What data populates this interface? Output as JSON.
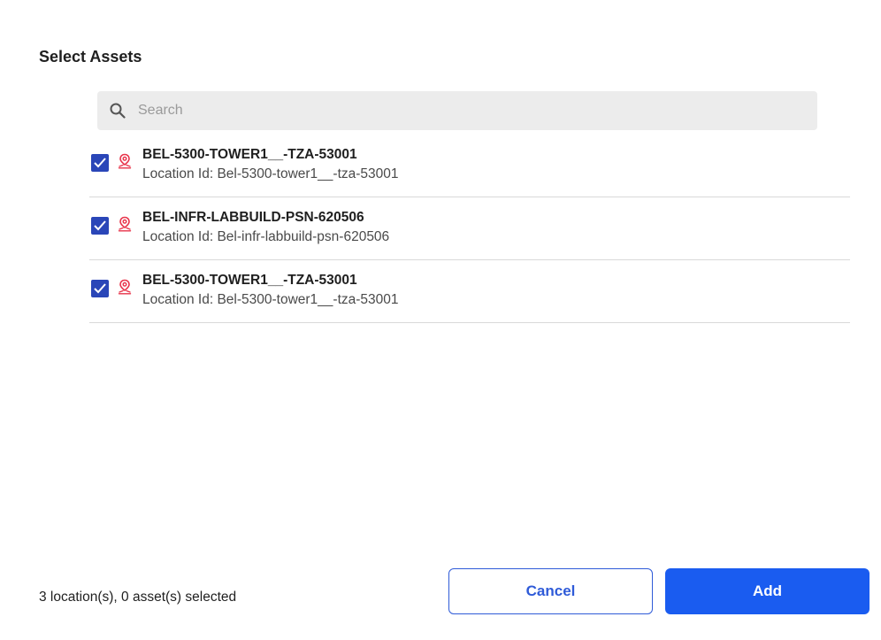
{
  "dialog": {
    "title": "Select Assets"
  },
  "search": {
    "placeholder": "Search",
    "value": ""
  },
  "items": [
    {
      "name": "BEL-5300-TOWER1__-TZA-53001",
      "location": "Location Id: Bel-5300-tower1__-tza-53001",
      "checked": true
    },
    {
      "name": "BEL-INFR-LABBUILD-PSN-620506",
      "location": "Location Id: Bel-infr-labbuild-psn-620506",
      "checked": true
    },
    {
      "name": "BEL-5300-TOWER1__-TZA-53001",
      "location": "Location Id: Bel-5300-tower1__-tza-53001",
      "checked": true
    }
  ],
  "footer": {
    "status": "3 location(s), 0 asset(s) selected",
    "cancel_label": "Cancel",
    "add_label": "Add"
  },
  "colors": {
    "checkbox": "#2a46b8",
    "location_icon": "#e8334a",
    "primary": "#1a5cf0"
  },
  "icons": {
    "search": "search-icon",
    "item": "location-pin-icon",
    "checkbox": "checkmark-icon"
  }
}
